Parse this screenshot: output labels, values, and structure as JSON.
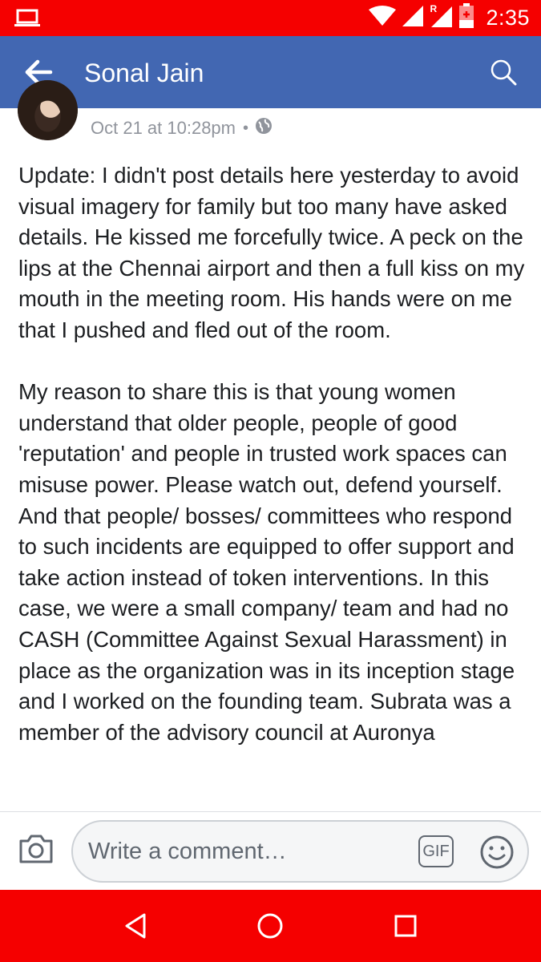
{
  "status_bar": {
    "time": "2:35",
    "icons": [
      "laptop-icon",
      "wifi-icon",
      "signal-icon",
      "roaming-signal-icon",
      "battery-charging-icon"
    ],
    "roaming_marker": "R"
  },
  "app_bar": {
    "title": "Sonal Jain",
    "back_icon": "arrow-left-icon",
    "search_icon": "search-icon",
    "color": "#4267b2"
  },
  "post": {
    "timestamp": "Oct 21 at 10:28pm",
    "separator": "•",
    "privacy_icon": "globe-icon",
    "paragraphs": [
      "Update: I didn't post details here yesterday to avoid visual imagery for family but too many have asked details. He kissed me forcefully twice. A peck on the lips at the Chennai airport and then a full kiss on my mouth in the meeting room. His hands were on me that I pushed and fled out of the room.",
      "My reason to share this is that young women understand that older people, people of good 'reputation' and people in trusted work spaces can misuse power. Please watch out, defend yourself. And that people/ bosses/ committees who respond to such incidents are equipped to offer support and take action instead of token interventions. In this case, we were a small company/ team and had no CASH (Committee Against Sexual Harassment) in place as the organization was in its inception stage and I worked on the founding team. Subrata was a member of the advisory council at Auronya"
    ]
  },
  "comment_bar": {
    "placeholder": "Write a comment…",
    "gif_label": "GIF",
    "camera_icon": "camera-icon",
    "emoji_icon": "smiley-icon"
  },
  "nav_bar": {
    "color": "#f50000",
    "icons": [
      "back-triangle-icon",
      "home-circle-icon",
      "recents-square-icon"
    ]
  }
}
